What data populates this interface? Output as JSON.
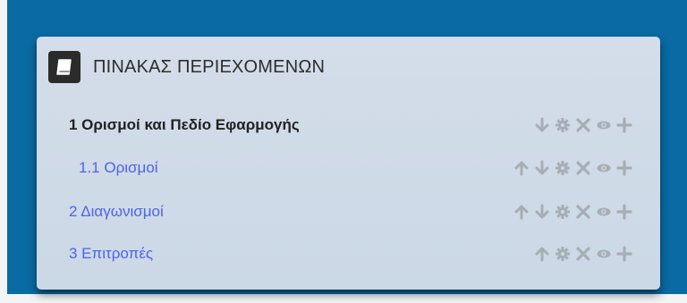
{
  "panel": {
    "title": "ΠΙΝΑΚΑΣ ΠΕΡΙΕΧΟΜΕΝΩΝ",
    "icon": "book-icon",
    "colors": {
      "background": "#0a6aa3",
      "panel": "#cfdae7",
      "link": "#4d63e8",
      "action_icon": "#a7adb4"
    }
  },
  "toc": {
    "items": [
      {
        "label": "1 Ορισμοί και Πεδίο Εφαρμογής",
        "style": "heading",
        "actions": [
          "arrow-down",
          "settings",
          "delete",
          "view",
          "add"
        ]
      },
      {
        "label": "1.1 Ορισμοί",
        "style": "link",
        "actions": [
          "arrow-up",
          "arrow-down",
          "settings",
          "delete",
          "view",
          "add"
        ]
      },
      {
        "label": "2 Διαγωνισμοί",
        "style": "link",
        "actions": [
          "arrow-up",
          "arrow-down",
          "settings",
          "delete",
          "view",
          "add"
        ]
      },
      {
        "label": "3 Επιτροπές",
        "style": "link",
        "actions": [
          "arrow-up",
          "settings",
          "delete",
          "view",
          "add"
        ]
      }
    ]
  }
}
